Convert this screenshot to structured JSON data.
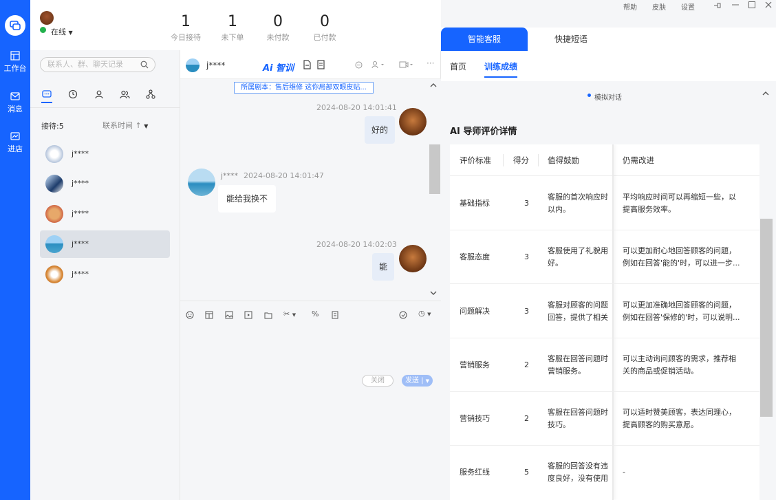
{
  "rail": {
    "items": [
      {
        "label": "工作台",
        "icon": "workbench-icon"
      },
      {
        "label": "消息",
        "icon": "message-icon"
      },
      {
        "label": "进店",
        "icon": "store-icon"
      }
    ]
  },
  "top": {
    "status": "在线",
    "stats": [
      {
        "value": "1",
        "label": "今日接待"
      },
      {
        "value": "1",
        "label": "未下单"
      },
      {
        "value": "0",
        "label": "未付款"
      },
      {
        "value": "0",
        "label": "已付款"
      }
    ],
    "window_links": [
      "帮助",
      "皮肤",
      "设置"
    ]
  },
  "sidebar": {
    "search_placeholder": "联系人、群、聊天记录",
    "reception_count": "接待:5",
    "sort_label": "联系时间",
    "contacts": [
      {
        "name": "j****"
      },
      {
        "name": "j****"
      },
      {
        "name": "j****"
      },
      {
        "name": "j****"
      },
      {
        "name": "j****"
      }
    ]
  },
  "chat": {
    "contact_name": "j****",
    "ai_label": "Ai 智训",
    "script_banner": "所属剧本：售后维修 这你局部双眼皮贴...",
    "messages": [
      {
        "side": "right",
        "time": "2024-08-20 14:01:41",
        "text": "好的"
      },
      {
        "side": "left",
        "name": "j****",
        "time": "2024-08-20 14:01:47",
        "text": "能给我换不"
      },
      {
        "side": "right",
        "time": "2024-08-20 14:02:03",
        "text": "能"
      }
    ],
    "close_label": "关闭",
    "send_label": "发送"
  },
  "right": {
    "tabs": [
      "智能客服",
      "快捷短语"
    ],
    "subtabs": [
      "首页",
      "训练成绩"
    ],
    "sim_label": "模拟对话",
    "eval_title": "AI 导师评价详情",
    "columns": [
      "评价标准",
      "得分",
      "值得鼓励",
      "仍需改进"
    ],
    "rows": [
      {
        "criterion": "基础指标",
        "score": "3",
        "good1": "客服的首次响应时",
        "good2": "以内。",
        "improve1": "平均响应时间可以再缩短一些，以",
        "improve2": "提高服务效率。"
      },
      {
        "criterion": "客服态度",
        "score": "3",
        "good1": "客服使用了礼貌用",
        "good2": "好。",
        "improve1": "可以更加耐心地回答顾客的问题，",
        "improve2": "例如在回答'能的'时，可以进一步..."
      },
      {
        "criterion": "问题解决",
        "score": "3",
        "good1": "客服对顾客的问题",
        "good2": "回答，提供了相关",
        "improve1": "可以更加准确地回答顾客的问题，",
        "improve2": "例如在回答'保修的'时，可以说明..."
      },
      {
        "criterion": "营销服务",
        "score": "2",
        "good1": "客服在回答问题时",
        "good2": "营销服务。",
        "improve1": "可以主动询问顾客的需求，推荐相",
        "improve2": "关的商品或促销活动。"
      },
      {
        "criterion": "营销技巧",
        "score": "2",
        "good1": "客服在回答问题时",
        "good2": "技巧。",
        "improve1": "可以适时赞美顾客，表达同理心，",
        "improve2": "提高顾客的购买意愿。"
      },
      {
        "criterion": "服务红线",
        "score": "5",
        "good1": "客服的回答没有违",
        "good2": "度良好，没有使用",
        "improve1": "-",
        "improve2": ""
      }
    ]
  }
}
